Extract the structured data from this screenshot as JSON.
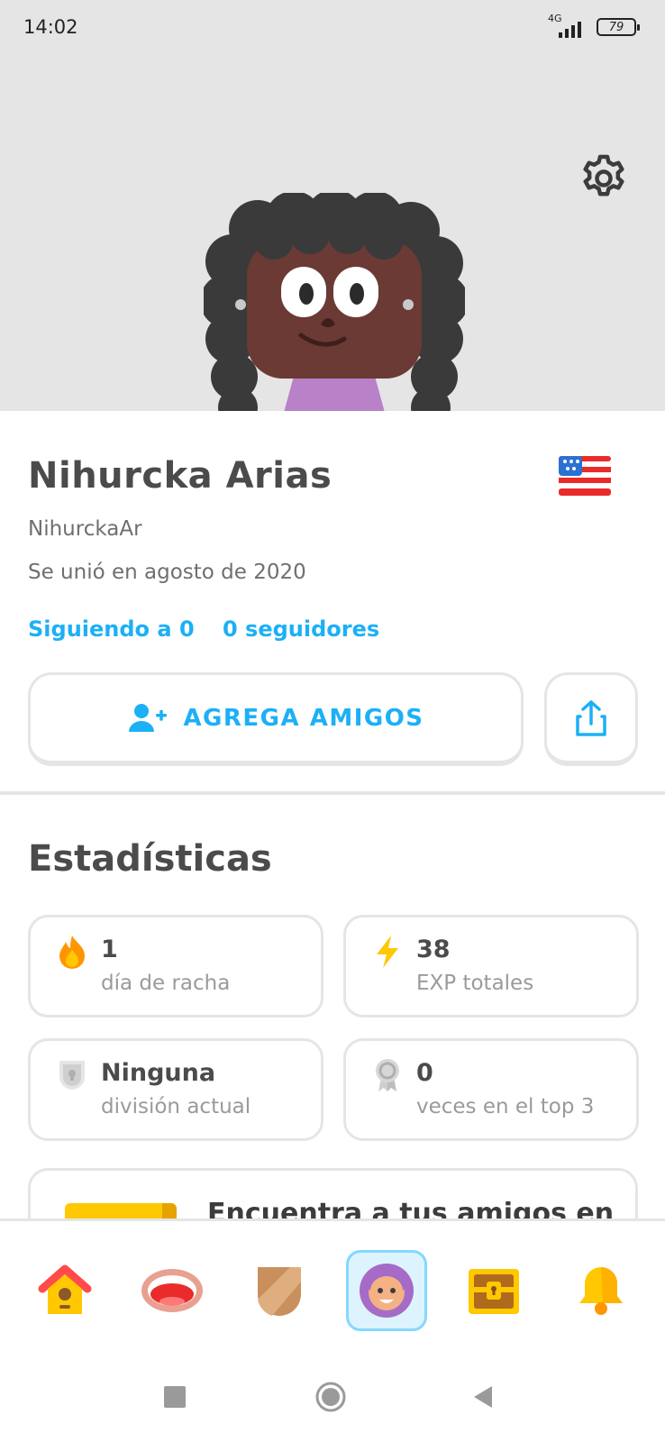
{
  "status_bar": {
    "time": "14:02",
    "network": "4G",
    "battery": "79"
  },
  "hero": {
    "settings_icon": "gear-icon",
    "avatar_icon": "user-avatar-illustration",
    "background_color": "#e5e5e5"
  },
  "profile": {
    "name": "Nihurcka Arias",
    "username": "NihurckaAr",
    "joined": "Se unió en agosto de 2020",
    "following": "Siguiendo a 0",
    "followers": "0 seguidores",
    "flag_icon": "us-flag-icon",
    "add_friends_label": "AGREGA AMIGOS",
    "add_friends_icon": "add-user-icon",
    "share_icon": "share-icon",
    "accent_color": "#1cb0f6"
  },
  "stats": {
    "title": "Estadísticas",
    "cards": [
      {
        "value": "1",
        "label": "día de racha",
        "icon": "flame-icon"
      },
      {
        "value": "38",
        "label": "EXP totales",
        "icon": "lightning-icon"
      },
      {
        "value": "Ninguna",
        "label": "división actual",
        "icon": "shield-lock-icon"
      },
      {
        "value": "0",
        "label": "veces en el top 3",
        "icon": "medal-icon"
      }
    ]
  },
  "promo": {
    "text": "Encuentra a tus amigos en"
  },
  "tabbar": {
    "tabs": [
      {
        "icon": "home-icon",
        "active": false
      },
      {
        "icon": "speaking-mouth-icon",
        "active": false
      },
      {
        "icon": "league-shield-icon",
        "active": false
      },
      {
        "icon": "profile-icon",
        "active": true
      },
      {
        "icon": "treasure-chest-icon",
        "active": false
      },
      {
        "icon": "bell-icon",
        "active": false
      }
    ]
  },
  "system_nav": {
    "buttons": [
      "recents-icon",
      "home-circle-icon",
      "back-icon"
    ]
  }
}
